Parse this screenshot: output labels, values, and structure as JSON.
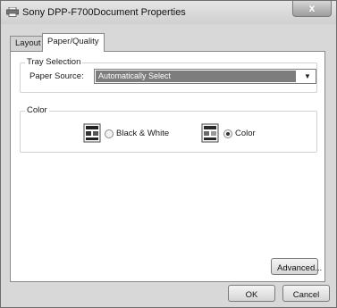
{
  "window": {
    "title": "Sony DPP-F700Document Properties",
    "close_label": "x",
    "icon": "printer-icon"
  },
  "tabs": [
    {
      "label": "Layout",
      "active": false
    },
    {
      "label": "Paper/Quality",
      "active": true
    }
  ],
  "tray_selection": {
    "group_label": "Tray Selection",
    "paper_source_label": "Paper Source:",
    "paper_source_value": "Automatically Select",
    "dropdown_icon": "chevron-down-icon"
  },
  "color": {
    "group_label": "Color",
    "options": [
      {
        "label": "Black & White",
        "checked": false,
        "icon": "document-bw-icon"
      },
      {
        "label": "Color",
        "checked": true,
        "icon": "document-color-icon"
      }
    ]
  },
  "buttons": {
    "advanced": "Advanced...",
    "ok": "OK",
    "cancel": "Cancel"
  }
}
